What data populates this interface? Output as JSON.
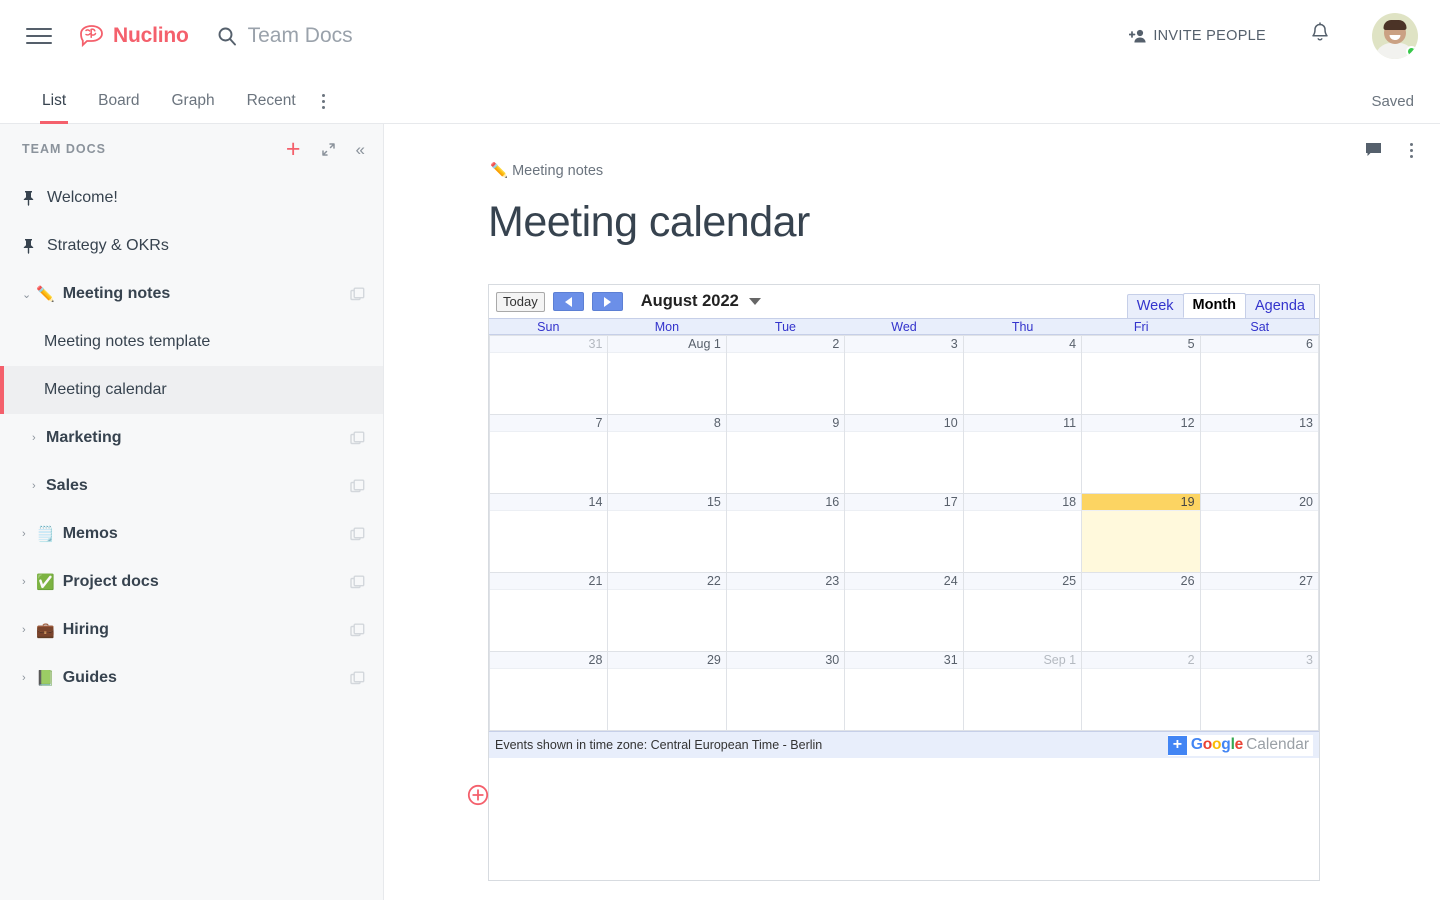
{
  "header": {
    "menu_icon": "hamburger-icon",
    "brand_name": "Nuclino",
    "search_placeholder": "Team Docs",
    "search_icon": "search-icon",
    "invite_label": "INVITE PEOPLE",
    "invite_icon": "add-person-icon",
    "notifications_icon": "bell-icon",
    "avatar_icon": "avatar",
    "brand_color": "#f4606c"
  },
  "tabbar": {
    "tabs": [
      {
        "label": "List",
        "active": true
      },
      {
        "label": "Board",
        "active": false
      },
      {
        "label": "Graph",
        "active": false
      },
      {
        "label": "Recent",
        "active": false
      }
    ],
    "more_icon": "more-vertical-icon",
    "save_status": "Saved"
  },
  "sidebar": {
    "title": "TEAM DOCS",
    "add_icon": "plus-icon",
    "expand_icon": "expand-icon",
    "collapse_icon": "collapse-left-icon",
    "items": [
      {
        "label": "Welcome!",
        "icon": "pin-icon",
        "emoji": "",
        "caret": "",
        "bold": false,
        "indent": 0,
        "active": false,
        "copy": false
      },
      {
        "label": "Strategy & OKRs",
        "icon": "pin-icon",
        "emoji": "",
        "caret": "",
        "bold": false,
        "indent": 0,
        "active": false,
        "copy": false
      },
      {
        "label": "Meeting notes",
        "icon": "",
        "emoji": "✏️",
        "caret": "⌄",
        "bold": true,
        "indent": 0,
        "active": false,
        "copy": true
      },
      {
        "label": "Meeting notes template",
        "icon": "",
        "emoji": "",
        "caret": "",
        "bold": false,
        "indent": 1,
        "active": false,
        "copy": false
      },
      {
        "label": "Meeting calendar",
        "icon": "",
        "emoji": "",
        "caret": "",
        "bold": false,
        "indent": 1,
        "active": true,
        "copy": false
      },
      {
        "label": "Marketing",
        "icon": "",
        "emoji": "",
        "caret": "›",
        "bold": true,
        "indent": 2,
        "active": false,
        "copy": true
      },
      {
        "label": "Sales",
        "icon": "",
        "emoji": "",
        "caret": "›",
        "bold": true,
        "indent": 2,
        "active": false,
        "copy": true
      },
      {
        "label": "Memos",
        "icon": "",
        "emoji": "🗒️",
        "caret": "›",
        "bold": true,
        "indent": 0,
        "active": false,
        "copy": true
      },
      {
        "label": "Project docs",
        "icon": "",
        "emoji": "✅",
        "caret": "›",
        "bold": true,
        "indent": 0,
        "active": false,
        "copy": true
      },
      {
        "label": "Hiring",
        "icon": "",
        "emoji": "💼",
        "caret": "›",
        "bold": true,
        "indent": 0,
        "active": false,
        "copy": true
      },
      {
        "label": "Guides",
        "icon": "",
        "emoji": "📗",
        "caret": "›",
        "bold": true,
        "indent": 0,
        "active": false,
        "copy": true
      }
    ]
  },
  "main": {
    "comment_icon": "comment-icon",
    "more_icon": "more-vertical-icon",
    "breadcrumb_emoji": "✏️",
    "breadcrumb_label": "Meeting notes",
    "page_title": "Meeting calendar",
    "add_block_icon": "add-block-icon"
  },
  "calendar": {
    "today_button": "Today",
    "prev_icon": "chevron-left-icon",
    "next_icon": "chevron-right-icon",
    "month_label": "August 2022",
    "dropdown_icon": "chevron-down-icon",
    "views": [
      {
        "label": "Week",
        "active": false
      },
      {
        "label": "Month",
        "active": true
      },
      {
        "label": "Agenda",
        "active": false
      }
    ],
    "daynames": [
      "Sun",
      "Mon",
      "Tue",
      "Wed",
      "Thu",
      "Fri",
      "Sat"
    ],
    "timezone_note": "Events shown in time zone: Central European Time - Berlin",
    "brand": {
      "plus": "+",
      "google_letters": [
        {
          "ch": "G",
          "color": "#4285f4"
        },
        {
          "ch": "o",
          "color": "#ea4335"
        },
        {
          "ch": "o",
          "color": "#fbbc05"
        },
        {
          "ch": "g",
          "color": "#4285f4"
        },
        {
          "ch": "l",
          "color": "#34a853"
        },
        {
          "ch": "e",
          "color": "#ea4335"
        }
      ],
      "calendar_word": "Calendar"
    },
    "weeks": [
      [
        {
          "label": "31",
          "other": true,
          "today": false
        },
        {
          "label": "Aug 1",
          "other": false,
          "today": false
        },
        {
          "label": "2",
          "other": false,
          "today": false
        },
        {
          "label": "3",
          "other": false,
          "today": false
        },
        {
          "label": "4",
          "other": false,
          "today": false
        },
        {
          "label": "5",
          "other": false,
          "today": false
        },
        {
          "label": "6",
          "other": false,
          "today": false
        }
      ],
      [
        {
          "label": "7",
          "other": false,
          "today": false
        },
        {
          "label": "8",
          "other": false,
          "today": false
        },
        {
          "label": "9",
          "other": false,
          "today": false
        },
        {
          "label": "10",
          "other": false,
          "today": false
        },
        {
          "label": "11",
          "other": false,
          "today": false
        },
        {
          "label": "12",
          "other": false,
          "today": false
        },
        {
          "label": "13",
          "other": false,
          "today": false
        }
      ],
      [
        {
          "label": "14",
          "other": false,
          "today": false
        },
        {
          "label": "15",
          "other": false,
          "today": false
        },
        {
          "label": "16",
          "other": false,
          "today": false
        },
        {
          "label": "17",
          "other": false,
          "today": false
        },
        {
          "label": "18",
          "other": false,
          "today": false
        },
        {
          "label": "19",
          "other": false,
          "today": true
        },
        {
          "label": "20",
          "other": false,
          "today": false
        }
      ],
      [
        {
          "label": "21",
          "other": false,
          "today": false
        },
        {
          "label": "22",
          "other": false,
          "today": false
        },
        {
          "label": "23",
          "other": false,
          "today": false
        },
        {
          "label": "24",
          "other": false,
          "today": false
        },
        {
          "label": "25",
          "other": false,
          "today": false
        },
        {
          "label": "26",
          "other": false,
          "today": false
        },
        {
          "label": "27",
          "other": false,
          "today": false
        }
      ],
      [
        {
          "label": "28",
          "other": false,
          "today": false
        },
        {
          "label": "29",
          "other": false,
          "today": false
        },
        {
          "label": "30",
          "other": false,
          "today": false
        },
        {
          "label": "31",
          "other": false,
          "today": false
        },
        {
          "label": "Sep 1",
          "other": true,
          "today": false
        },
        {
          "label": "2",
          "other": true,
          "today": false
        },
        {
          "label": "3",
          "other": true,
          "today": false
        }
      ]
    ]
  }
}
